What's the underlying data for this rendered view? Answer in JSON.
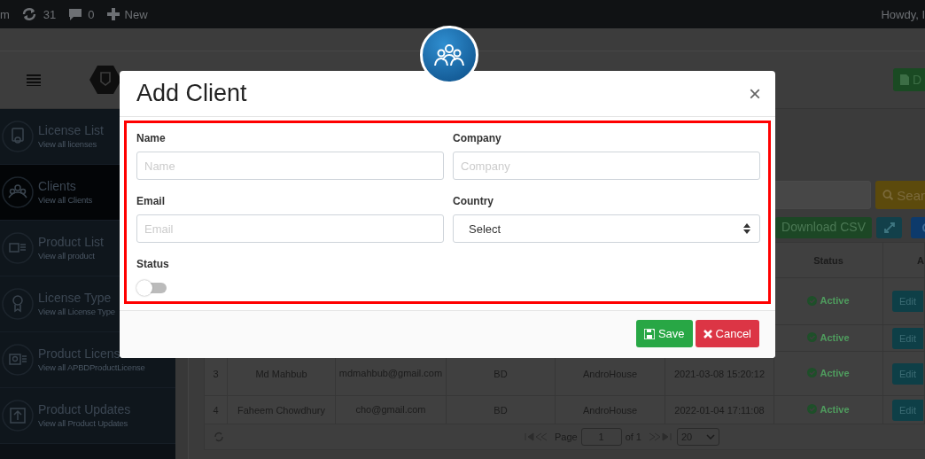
{
  "admin_bar": {
    "items": [
      {
        "kind": "text",
        "label": "m"
      },
      {
        "kind": "updates",
        "label": "31"
      },
      {
        "kind": "comments",
        "label": "0"
      },
      {
        "kind": "new",
        "label": "New"
      }
    ],
    "greeting": "Howdy, I"
  },
  "header": {
    "action_button": "D"
  },
  "sidebar": {
    "items": [
      {
        "title": "License List",
        "subtitle": "View all licenses",
        "selected": false
      },
      {
        "title": "Clients",
        "subtitle": "View all Clients",
        "selected": true
      },
      {
        "title": "Product List",
        "subtitle": "View all product",
        "selected": false
      },
      {
        "title": "License Type",
        "subtitle": "View all License Type",
        "selected": false
      },
      {
        "title": "Product Licens",
        "subtitle": "View all APBDProductLicense",
        "selected": false
      },
      {
        "title": "Product Updates",
        "subtitle": "View all Product Updates",
        "selected": false
      }
    ]
  },
  "toolbar": {
    "search_button": "Sear",
    "download_button": "Download CSV"
  },
  "table": {
    "columns": [
      "Status",
      "A"
    ],
    "rows": [
      {
        "status": "Active",
        "action": "Edit"
      },
      {
        "status": "Active",
        "action": "Edit"
      },
      {
        "number": "3",
        "name": "Md Mahbub",
        "email": "mdmahbub@gmail.com",
        "country": "BD",
        "company": "AndroHouse",
        "date": "2021-03-08 15:20:12",
        "status": "Active",
        "action": "Edit"
      },
      {
        "number": "4",
        "name": "Faheem Chowdhury",
        "email": "cho@gmail.com",
        "country": "BD",
        "company": "AndroHouse",
        "date": "2022-01-04 17:11:08",
        "status": "Active",
        "action": "Edit"
      }
    ],
    "pager": {
      "page_label": "Page",
      "page": "1",
      "of": "of 1",
      "page_size": "20"
    }
  },
  "modal": {
    "title": "Add Client",
    "close": "×",
    "fields": [
      {
        "kind": "text",
        "label": "Name",
        "placeholder": "Name"
      },
      {
        "kind": "text",
        "label": "Company",
        "placeholder": "Company"
      },
      {
        "kind": "text",
        "label": "Email",
        "placeholder": "Email"
      },
      {
        "kind": "select",
        "label": "Country",
        "value": "Select"
      },
      {
        "kind": "toggle",
        "label": "Status",
        "on": false
      }
    ],
    "buttons": [
      {
        "kind": "save",
        "label": "Save"
      },
      {
        "kind": "cancel",
        "label": "Cancel"
      }
    ]
  }
}
